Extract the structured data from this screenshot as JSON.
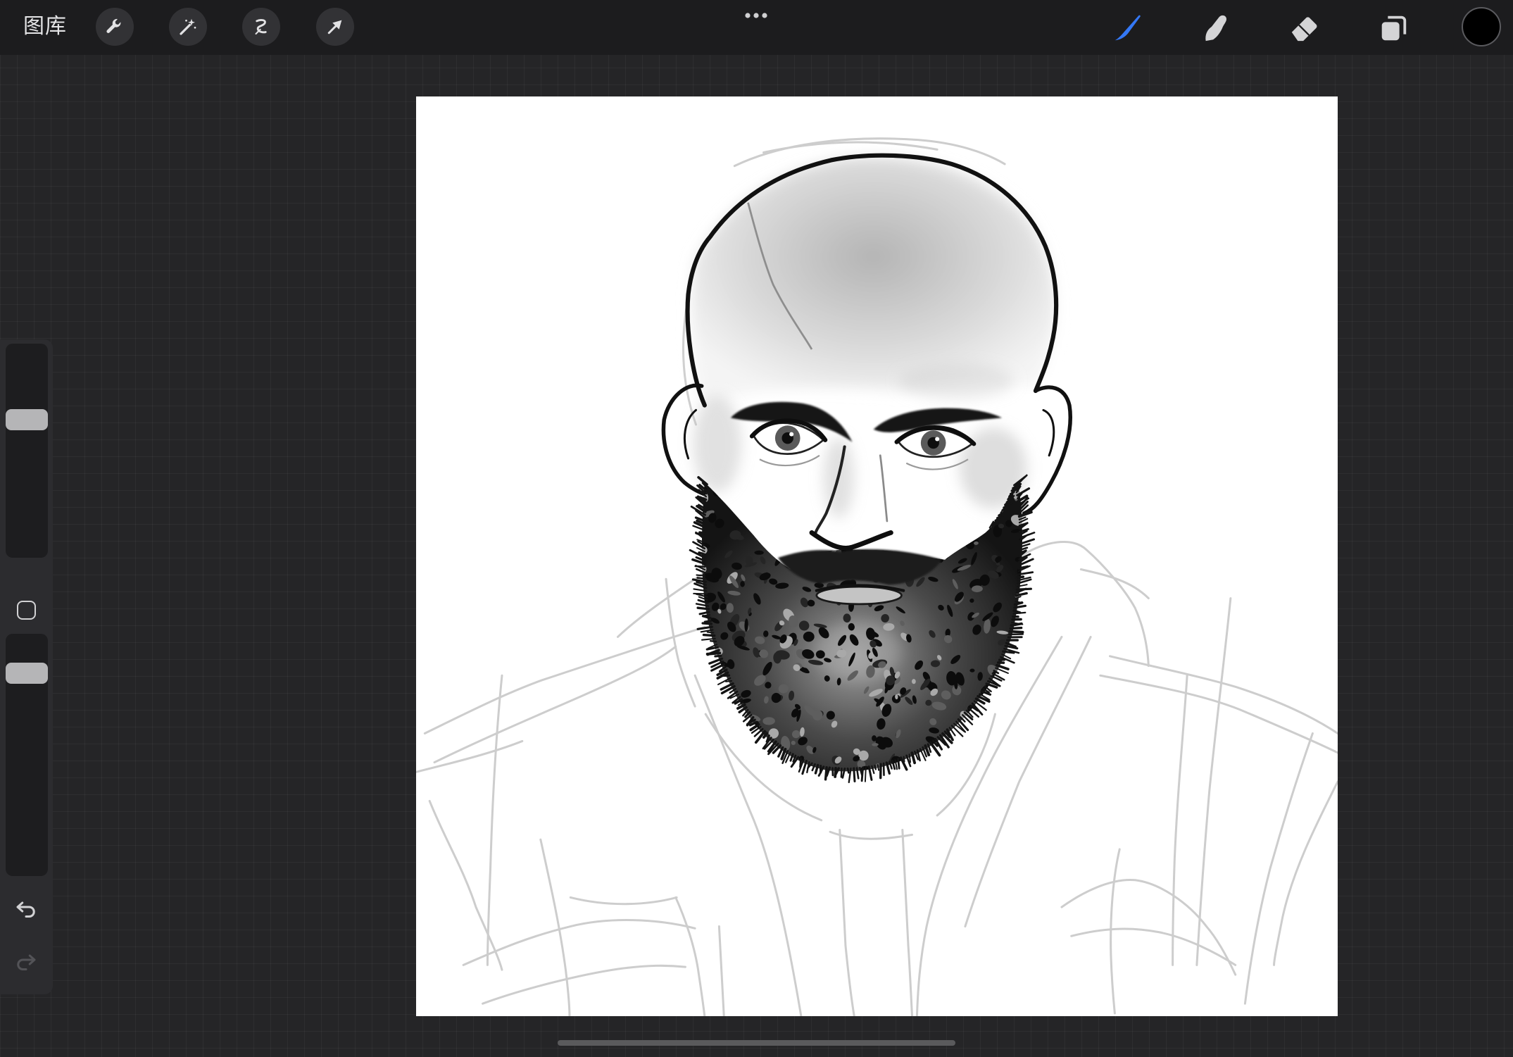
{
  "top_bar": {
    "gallery_label": "图库",
    "left_tools": [
      "wrench-icon",
      "magic-wand-icon",
      "selection-icon",
      "transform-arrow-icon"
    ],
    "more_menu_icon": "more-dots-icon",
    "right_tools": [
      "brush-icon",
      "smudge-icon",
      "eraser-icon",
      "layers-icon"
    ],
    "active_tool": "brush-icon",
    "active_tool_color": "#3478f6",
    "inactive_tool_color": "#d4d4d6",
    "current_color": "#000000"
  },
  "sidebar": {
    "brush_size_level": 0.66,
    "opacity_level": 0.87,
    "modify_button_icon": "square-icon",
    "undo_icon": "undo-icon",
    "redo_icon": "redo-icon",
    "redo_enabled": false
  },
  "canvas": {
    "background_color": "#ffffff"
  }
}
